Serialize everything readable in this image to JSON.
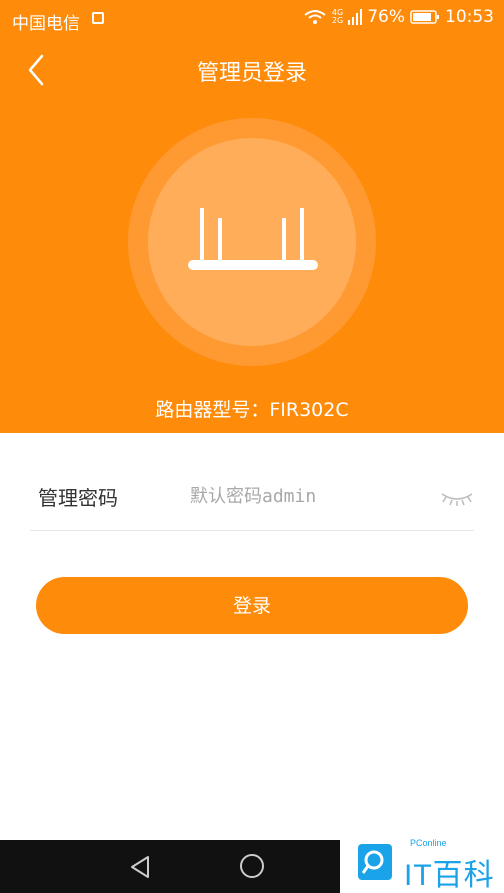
{
  "status_bar": {
    "carrier": "中国电信",
    "network_top": "4G",
    "network_bottom": "2G",
    "battery": "76%",
    "time": "10:53"
  },
  "header": {
    "title": "管理员登录",
    "back_icon": "chevron-left-icon"
  },
  "router": {
    "icon": "router-icon",
    "model_label": "路由器型号：FIR302C"
  },
  "form": {
    "password_label": "管理密码",
    "password_placeholder": "默认密码admin",
    "password_value": "",
    "visibility_icon": "eye-closed-icon"
  },
  "login_button": "登录",
  "navbar": {
    "back_icon": "triangle-back-icon",
    "home_icon": "circle-home-icon"
  },
  "watermark": {
    "small_text": "PConline",
    "text": "IT百科"
  },
  "colors": {
    "accent": "#ff8b0b",
    "ring": "#ff9a33",
    "circle": "#ffad59"
  }
}
